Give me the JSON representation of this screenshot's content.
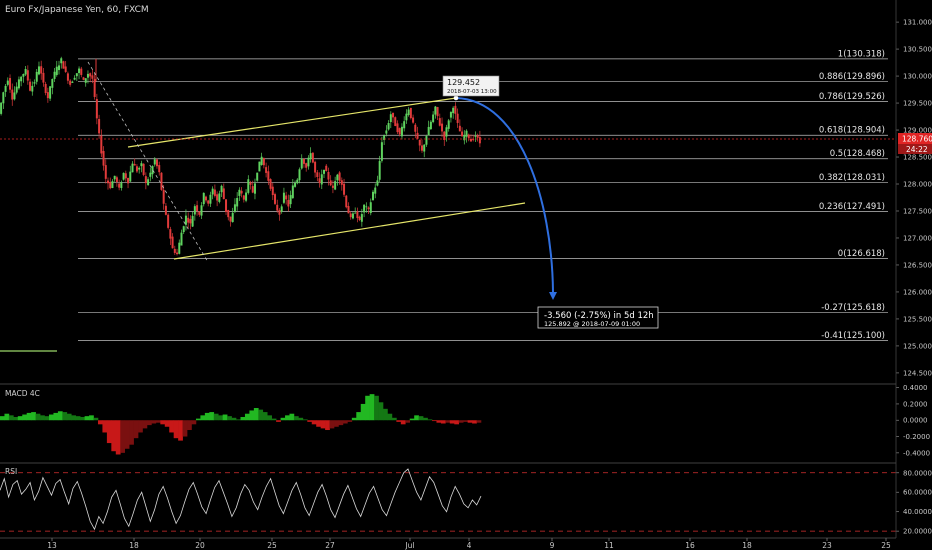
{
  "header": {
    "title": "Euro Fx/Japanese Yen, 60, FXCM"
  },
  "colors": {
    "background": "#000000",
    "up_candle": "#5fd35f",
    "down_candle": "#e23b3b",
    "fib_line": "#bfbfbf",
    "channel": "#e6e66a",
    "projection": "#2f6fe0",
    "price_marker": "#e02424",
    "rsi_line": "#d8d8d8",
    "rsi_band": "#d83030",
    "macd_up": "#22b822",
    "macd_down": "#c81818"
  },
  "icons": {
    "arrowhead": "arrow-down-icon"
  },
  "chart_data": {
    "type": "candlestick",
    "symbol": "Euro Fx/Japanese Yen",
    "timeframe": "60",
    "source": "FXCM",
    "price_axis": {
      "ticks": [
        "131.000",
        "130.500",
        "130.000",
        "129.500",
        "129.000",
        "128.500",
        "128.000",
        "127.500",
        "127.000",
        "126.500",
        "126.000",
        "125.500",
        "125.000",
        "124.500"
      ],
      "range": [
        124.35,
        131.15
      ]
    },
    "time_axis": {
      "labels": [
        "13",
        "18",
        "20",
        "25",
        "27",
        "Jul",
        "4",
        "9",
        "11",
        "16",
        "18",
        "23",
        "25"
      ]
    },
    "current_price": {
      "value": "128.760",
      "countdown": "24:22"
    },
    "fibonacci": [
      {
        "label": "1(130.318)",
        "level": 130.318
      },
      {
        "label": "0.886(129.896)",
        "level": 129.896
      },
      {
        "label": "0.786(129.526)",
        "level": 129.526
      },
      {
        "label": "0.618(128.904)",
        "level": 128.904
      },
      {
        "label": "0.5(128.468)",
        "level": 128.468
      },
      {
        "label": "0.382(128.031)",
        "level": 128.031
      },
      {
        "label": "0.236(127.491)",
        "level": 127.491
      },
      {
        "label": "0(126.618)",
        "level": 126.618
      },
      {
        "label": "-0.27(125.618)",
        "level": 125.618
      },
      {
        "label": "-0.41(125.100)",
        "level": 125.1
      }
    ],
    "annotations": {
      "peak_label_price": "129.452",
      "peak_label_time": "2018-07-03 13:00",
      "projection_change": "-3.560 (-2.75%) in 5d 12h",
      "projection_target": "125.892 @ 2018-07-09 01:00"
    },
    "price_path": [
      [
        0,
        129.3
      ],
      [
        2,
        129.7
      ],
      [
        4,
        129.95
      ],
      [
        6,
        129.6
      ],
      [
        8,
        129.8
      ],
      [
        10,
        130.0
      ],
      [
        12,
        130.1
      ],
      [
        14,
        129.75
      ],
      [
        16,
        129.9
      ],
      [
        18,
        130.2
      ],
      [
        20,
        129.85
      ],
      [
        22,
        129.6
      ],
      [
        24,
        129.95
      ],
      [
        26,
        130.15
      ],
      [
        28,
        130.3
      ],
      [
        30,
        130.05
      ],
      [
        32,
        129.85
      ],
      [
        34,
        130.0
      ],
      [
        36,
        130.12
      ],
      [
        38,
        129.9
      ],
      [
        40,
        130.05
      ],
      [
        42,
        129.95
      ],
      [
        44,
        129.2
      ],
      [
        46,
        128.6
      ],
      [
        48,
        128.1
      ],
      [
        50,
        127.95
      ],
      [
        52,
        128.15
      ],
      [
        54,
        127.9
      ],
      [
        56,
        128.2
      ],
      [
        58,
        128.05
      ],
      [
        60,
        128.4
      ],
      [
        62,
        128.25
      ],
      [
        64,
        128.35
      ],
      [
        66,
        128.0
      ],
      [
        68,
        128.2
      ],
      [
        70,
        128.45
      ],
      [
        72,
        128.2
      ],
      [
        74,
        127.6
      ],
      [
        76,
        127.2
      ],
      [
        78,
        126.8
      ],
      [
        80,
        126.7
      ],
      [
        82,
        127.1
      ],
      [
        84,
        127.4
      ],
      [
        86,
        127.25
      ],
      [
        88,
        127.6
      ],
      [
        90,
        127.45
      ],
      [
        92,
        127.8
      ],
      [
        94,
        127.65
      ],
      [
        96,
        127.9
      ],
      [
        98,
        127.7
      ],
      [
        100,
        127.95
      ],
      [
        102,
        127.5
      ],
      [
        104,
        127.3
      ],
      [
        106,
        127.6
      ],
      [
        108,
        127.9
      ],
      [
        110,
        127.7
      ],
      [
        112,
        128.05
      ],
      [
        114,
        127.85
      ],
      [
        116,
        128.25
      ],
      [
        118,
        128.5
      ],
      [
        120,
        128.2
      ],
      [
        122,
        127.95
      ],
      [
        124,
        127.6
      ],
      [
        126,
        127.45
      ],
      [
        128,
        127.8
      ],
      [
        130,
        127.6
      ],
      [
        132,
        127.95
      ],
      [
        134,
        128.1
      ],
      [
        136,
        128.5
      ],
      [
        138,
        128.3
      ],
      [
        140,
        128.6
      ],
      [
        142,
        128.2
      ],
      [
        144,
        128.0
      ],
      [
        146,
        128.3
      ],
      [
        148,
        128.1
      ],
      [
        150,
        127.9
      ],
      [
        152,
        128.2
      ],
      [
        154,
        128.0
      ],
      [
        156,
        127.6
      ],
      [
        158,
        127.35
      ],
      [
        160,
        127.5
      ],
      [
        162,
        127.3
      ],
      [
        164,
        127.6
      ],
      [
        166,
        127.5
      ],
      [
        168,
        127.85
      ],
      [
        170,
        128.05
      ],
      [
        172,
        128.8
      ],
      [
        174,
        129.0
      ],
      [
        176,
        129.3
      ],
      [
        178,
        129.1
      ],
      [
        180,
        128.9
      ],
      [
        182,
        129.2
      ],
      [
        184,
        129.4
      ],
      [
        186,
        129.1
      ],
      [
        188,
        128.8
      ],
      [
        190,
        128.6
      ],
      [
        192,
        128.9
      ],
      [
        194,
        129.15
      ],
      [
        196,
        129.4
      ],
      [
        198,
        129.1
      ],
      [
        200,
        128.85
      ],
      [
        202,
        129.2
      ],
      [
        204,
        129.45
      ],
      [
        206,
        129.1
      ],
      [
        208,
        128.85
      ],
      [
        210,
        128.95
      ],
      [
        212,
        128.8
      ],
      [
        214,
        128.9
      ],
      [
        216,
        128.76
      ]
    ],
    "macd_histogram": [
      0.05,
      0.08,
      0.06,
      0.04,
      0.05,
      0.07,
      0.09,
      0.1,
      0.08,
      0.06,
      0.05,
      0.07,
      0.09,
      0.11,
      0.1,
      0.08,
      0.06,
      0.05,
      0.04,
      0.05,
      0.06,
      0.03,
      -0.05,
      -0.15,
      -0.28,
      -0.38,
      -0.42,
      -0.4,
      -0.35,
      -0.3,
      -0.22,
      -0.15,
      -0.1,
      -0.06,
      -0.04,
      -0.03,
      -0.05,
      -0.08,
      -0.15,
      -0.22,
      -0.25,
      -0.2,
      -0.12,
      -0.05,
      0.02,
      0.06,
      0.09,
      0.1,
      0.08,
      0.06,
      0.07,
      0.05,
      0.03,
      0.01,
      0.04,
      0.08,
      0.12,
      0.15,
      0.13,
      0.1,
      0.06,
      0.02,
      -0.02,
      0.03,
      0.06,
      0.08,
      0.05,
      0.03,
      0.01,
      -0.02,
      -0.05,
      -0.08,
      -0.1,
      -0.12,
      -0.1,
      -0.08,
      -0.06,
      -0.04,
      -0.02,
      0.03,
      0.1,
      0.2,
      0.3,
      0.32,
      0.3,
      0.22,
      0.14,
      0.08,
      0.03,
      -0.02,
      -0.05,
      -0.03,
      0.02,
      0.06,
      0.05,
      0.03,
      0.01,
      -0.01,
      -0.03,
      -0.04,
      -0.03,
      -0.04,
      -0.05,
      -0.03,
      -0.02,
      -0.03,
      -0.04,
      -0.03
    ],
    "macd_axis": {
      "label": "MACD 4C",
      "ticks": [
        "0.4000",
        "0.2000",
        "0.0000",
        "-0.2000",
        "-0.4000"
      ],
      "range": [
        -0.5,
        0.42
      ]
    },
    "rsi_axis": {
      "label": "RSI",
      "ticks": [
        "80.0000",
        "60.0000",
        "40.0000",
        "20.0000"
      ],
      "range": [
        15,
        88
      ],
      "bands": [
        80,
        20
      ]
    },
    "rsi_values": [
      62,
      74,
      55,
      68,
      72,
      58,
      63,
      70,
      52,
      61,
      75,
      66,
      57,
      69,
      73,
      60,
      48,
      64,
      71,
      59,
      45,
      30,
      22,
      35,
      28,
      40,
      55,
      62,
      48,
      33,
      25,
      38,
      52,
      60,
      45,
      30,
      42,
      58,
      66,
      54,
      40,
      28,
      36,
      50,
      63,
      70,
      58,
      45,
      38,
      52,
      65,
      72,
      60,
      48,
      35,
      44,
      58,
      68,
      62,
      50,
      42,
      55,
      66,
      74,
      60,
      46,
      38,
      50,
      62,
      70,
      58,
      44,
      36,
      48,
      60,
      68,
      56,
      42,
      34,
      46,
      58,
      67,
      55,
      43,
      35,
      47,
      59,
      66,
      54,
      42,
      36,
      48,
      60,
      70,
      80,
      84,
      72,
      60,
      52,
      64,
      76,
      70,
      58,
      46,
      40,
      55,
      66,
      58,
      48,
      44,
      52,
      47,
      56
    ]
  }
}
